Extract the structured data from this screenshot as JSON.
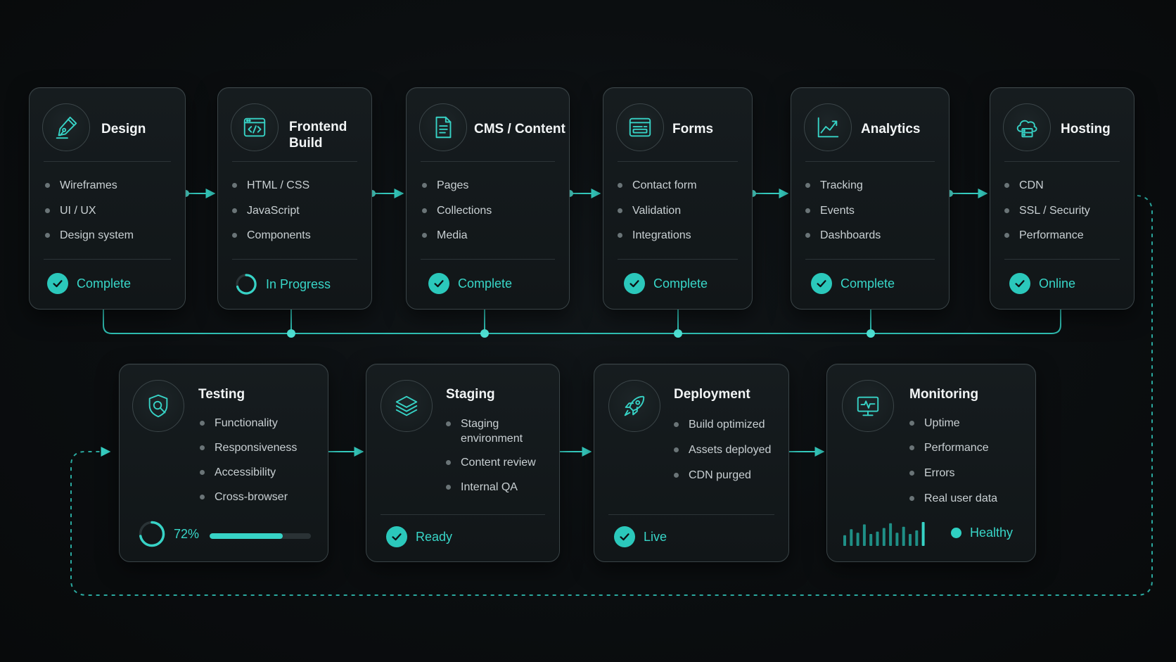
{
  "colors": {
    "accent": "#37d3c6",
    "card_bg": "#14191c",
    "text_muted": "#c9d0d3"
  },
  "stages": {
    "design": {
      "title": "Design",
      "icon": "pen-nib-icon",
      "items": [
        "Wireframes",
        "UI / UX",
        "Design system"
      ],
      "status": "Complete"
    },
    "frontend": {
      "title": "Frontend\nBuild",
      "icon": "code-window-icon",
      "items": [
        "HTML / CSS",
        "JavaScript",
        "Components"
      ],
      "status": "In Progress"
    },
    "cms": {
      "title": "CMS / Content",
      "icon": "document-icon",
      "items": [
        "Pages",
        "Collections",
        "Media"
      ],
      "status": "Complete"
    },
    "forms": {
      "title": "Forms",
      "icon": "form-window-icon",
      "items": [
        "Contact form",
        "Validation",
        "Integrations"
      ],
      "status": "Complete"
    },
    "analytics": {
      "title": "Analytics",
      "icon": "line-chart-icon",
      "items": [
        "Tracking",
        "Events",
        "Dashboards"
      ],
      "status": "Complete"
    },
    "hosting": {
      "title": "Hosting",
      "icon": "cloud-server-icon",
      "items": [
        "CDN",
        "SSL / Security",
        "Performance"
      ],
      "status": "Online"
    },
    "testing": {
      "title": "Testing",
      "icon": "shield-search-icon",
      "items": [
        "Functionality",
        "Responsiveness",
        "Accessibility",
        "Cross-browser"
      ],
      "progress_label": "72%",
      "progress": 0.72
    },
    "staging": {
      "title": "Staging",
      "icon": "layers-icon",
      "items": [
        "Staging\nenvironment",
        "Content review",
        "Internal QA"
      ],
      "status": "Ready"
    },
    "deployment": {
      "title": "Deployment",
      "icon": "rocket-icon",
      "items": [
        "Build optimized",
        "Assets deployed",
        "CDN purged"
      ],
      "status": "Live"
    },
    "monitoring": {
      "title": "Monitoring",
      "icon": "monitor-pulse-icon",
      "items": [
        "Uptime",
        "Performance",
        "Errors",
        "Real user data"
      ],
      "status": "Healthy",
      "activity": [
        0.45,
        0.7,
        0.55,
        0.9,
        0.5,
        0.6,
        0.75,
        0.95,
        0.55,
        0.8,
        0.5,
        0.65,
        1.0
      ]
    }
  }
}
